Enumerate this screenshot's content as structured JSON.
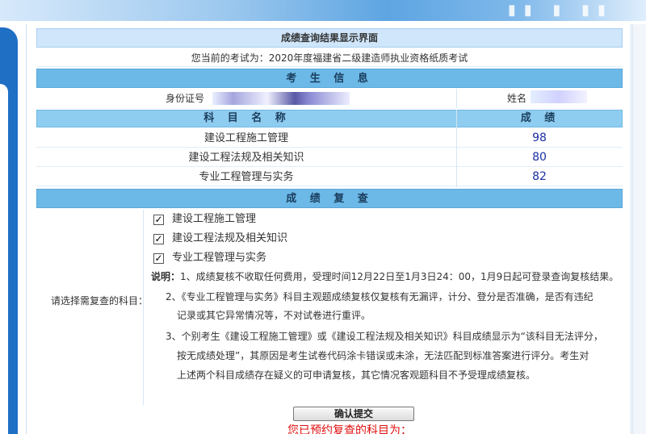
{
  "page": {
    "title": "成绩查询结果显示界面",
    "exam_line": "您当前的考试为：2020年度福建省二级建造师执业资格纸质考试"
  },
  "colors": {
    "section_bar": "#6cb9e8",
    "header_bar": "#8fcdf0",
    "score_text": "#1a2fa0",
    "reserved_text": "#e01010",
    "frame_blue": "#1f6fc5"
  },
  "candidate": {
    "section_title": "考 生 信 息",
    "id_label": "身份证号",
    "name_label": "姓名"
  },
  "scores": {
    "header_subject": "科 目 名 称",
    "header_score": "成 绩",
    "rows": [
      {
        "subject": "建设工程施工管理",
        "score": "98"
      },
      {
        "subject": "建设工程法规及相关知识",
        "score": "80"
      },
      {
        "subject": "专业工程管理与实务",
        "score": "82"
      }
    ]
  },
  "review": {
    "section_title": "成 绩 复 查",
    "select_label": "请选择需复查的科目：",
    "options": [
      {
        "label": "建设工程施工管理",
        "checked": true
      },
      {
        "label": "建设工程法规及相关知识",
        "checked": true
      },
      {
        "label": "专业工程管理与实务",
        "checked": true
      }
    ],
    "note_title": "说明：",
    "note_1": "1、成绩复核不收取任何费用，受理时间12月22日至1月3日24：00，1月9日起可登录查询复核结果。",
    "note_2a": "2、《专业工程管理与实务》科目主观题成绩复核仅复核有无漏评，计分、登分是否准确，是否有违纪",
    "note_2b": "记录或其它异常情况等，不对试卷进行重评。",
    "note_3a": "3、个别考生《建设工程施工管理》或《建设工程法规及相关知识》科目成绩显示为“该科目无法评分，",
    "note_3b": "按无成绩处理”，其原因是考生试卷代码涂卡错误或未涂，无法匹配到标准答案进行评分。考生对",
    "note_3c": "上述两个科目成绩存在疑义的可申请复核，其它情况客观题科目不予受理成绩复核。",
    "submit_label": "确认提交",
    "reserved_text": "您已预约复查的科目为："
  }
}
